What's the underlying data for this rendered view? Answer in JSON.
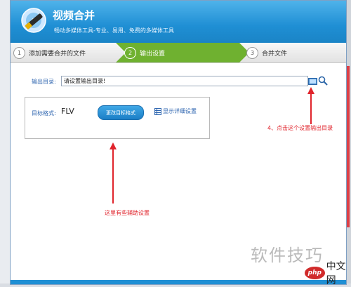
{
  "app": {
    "title": "视频合并",
    "subtitle": "畅动多媒体工具-专业、易用、免费的多媒体工具"
  },
  "steps": [
    {
      "num": "1",
      "label": "添加需要合并的文件"
    },
    {
      "num": "2",
      "label": "输出设置"
    },
    {
      "num": "3",
      "label": "合并文件"
    }
  ],
  "output": {
    "label": "输出目录:",
    "value": "请设置输出目录!"
  },
  "format": {
    "label": "目标格式:",
    "value": "FLV",
    "change_button": "更改目标格式",
    "detail_link": "显示详细设置"
  },
  "annotations": {
    "set_dir_note": "4、点击这个设置输出目录",
    "aux_note": "这里有些辅助设置"
  },
  "watermark": {
    "text": "软件技巧",
    "logo_php": "php",
    "logo_cn": "中文网"
  },
  "colors": {
    "accent": "#1f8fd4",
    "active_step": "#6fb130",
    "annotation": "#e0242c"
  }
}
